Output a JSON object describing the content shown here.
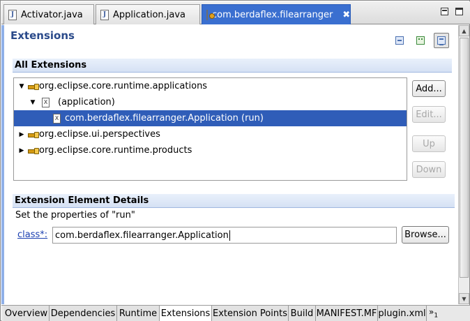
{
  "editor_tabs": [
    {
      "label": "Activator.java",
      "icon": "java-file-icon",
      "icon_letter": "J"
    },
    {
      "label": "Application.java",
      "icon": "java-file-icon",
      "icon_letter": "J"
    },
    {
      "label": "com.berdaflex.filearranger",
      "icon": "plugin-manifest-icon",
      "active": true,
      "close": "✖"
    }
  ],
  "form": {
    "title": "Extensions",
    "tools": [
      "collapse-all-icon",
      "sort-icon",
      "show-details-icon"
    ]
  },
  "all_extensions": {
    "header": "All Extensions",
    "tree": [
      {
        "label": "org.eclipse.core.runtime.applications",
        "level": 0,
        "expanded": true,
        "icon": "extension-icon"
      },
      {
        "label": "(application)",
        "level": 1,
        "expanded": true,
        "icon": "element-icon"
      },
      {
        "label": "com.berdaflex.filearranger.Application (run)",
        "level": 2,
        "selected": true,
        "icon": "element-icon"
      },
      {
        "label": "org.eclipse.ui.perspectives",
        "level": 0,
        "expanded": false,
        "icon": "extension-icon"
      },
      {
        "label": "org.eclipse.core.runtime.products",
        "level": 0,
        "expanded": false,
        "icon": "extension-icon"
      }
    ],
    "buttons": {
      "add": "Add...",
      "edit": "Edit...",
      "up": "Up",
      "down": "Down"
    }
  },
  "details": {
    "header": "Extension Element Details",
    "subtitle": "Set the properties of \"run\"",
    "class_label": "class*:",
    "class_value": "com.berdaflex.filearranger.Application",
    "browse": "Browse..."
  },
  "bottom_tabs": [
    {
      "label": "Overview"
    },
    {
      "label": "Dependencies"
    },
    {
      "label": "Runtime"
    },
    {
      "label": "Extensions",
      "active": true
    },
    {
      "label": "Extension Points"
    },
    {
      "label": "Build"
    },
    {
      "label": "MANIFEST.MF"
    },
    {
      "label": "plugin.xml"
    }
  ],
  "more_tabs": {
    "glyph": "»",
    "count": "1"
  }
}
